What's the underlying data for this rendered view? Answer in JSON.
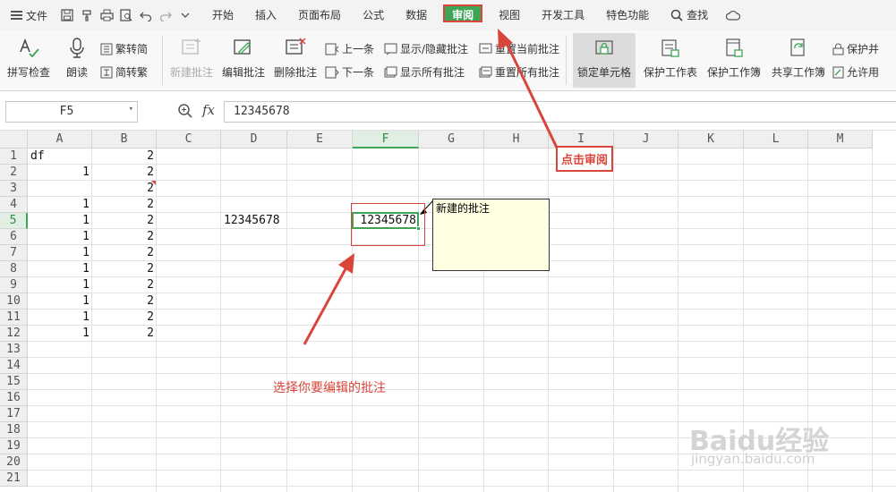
{
  "menubar": {
    "file_label": "文件",
    "tabs": [
      {
        "label": "开始"
      },
      {
        "label": "插入"
      },
      {
        "label": "页面布局"
      },
      {
        "label": "公式"
      },
      {
        "label": "数据"
      },
      {
        "label": "审阅",
        "active": true
      },
      {
        "label": "视图"
      },
      {
        "label": "开发工具"
      },
      {
        "label": "特色功能"
      }
    ],
    "search_label": "查找",
    "quick_icons": [
      "save-icon",
      "format-painter-icon",
      "print-icon",
      "print-preview-icon",
      "undo-icon",
      "redo-icon",
      "dropdown-icon"
    ]
  },
  "ribbon": {
    "spell_check": "拼写检查",
    "read_aloud": "朗读",
    "trad_to_simp": "繁转简",
    "simp_to_trad": "简转繁",
    "new_comment": "新建批注",
    "edit_comment": "编辑批注",
    "delete_comment": "删除批注",
    "prev": "上一条",
    "next": "下一条",
    "show_hide_comment": "显示/隐藏批注",
    "show_all_comments": "显示所有批注",
    "reset_current_comment": "重置当前批注",
    "reset_all_comments": "重置所有批注",
    "lock_cell": "锁定单元格",
    "protect_sheet": "保护工作表",
    "protect_workbook": "保护工作簿",
    "share_workbook": "共享工作簿",
    "protect_and": "保护并",
    "allow_edit": "允许用"
  },
  "formula_bar": {
    "name_box": "F5",
    "fx": "fx",
    "value": "12345678"
  },
  "sheet": {
    "columns": [
      "A",
      "B",
      "C",
      "D",
      "E",
      "F",
      "G",
      "H",
      "I",
      "J",
      "K",
      "L",
      "M"
    ],
    "selected_column": "F",
    "rows": [
      "1",
      "2",
      "3",
      "4",
      "5",
      "6",
      "7",
      "8",
      "9",
      "10",
      "11",
      "12",
      "13",
      "14",
      "15",
      "16",
      "17",
      "18",
      "19",
      "20",
      "21"
    ],
    "selected_row": "5",
    "cells": [
      {
        "ref": "A1",
        "value": "df",
        "align": "left"
      },
      {
        "ref": "B1",
        "value": "2",
        "align": "right"
      },
      {
        "ref": "A2",
        "value": "1",
        "align": "right"
      },
      {
        "ref": "B2",
        "value": "2",
        "align": "right"
      },
      {
        "ref": "B3",
        "value": "2",
        "align": "right"
      },
      {
        "ref": "A4",
        "value": "1",
        "align": "right"
      },
      {
        "ref": "B4",
        "value": "2",
        "align": "right"
      },
      {
        "ref": "A5",
        "value": "1",
        "align": "right"
      },
      {
        "ref": "B5",
        "value": "2",
        "align": "right"
      },
      {
        "ref": "D5",
        "value": "12345678",
        "align": "left"
      },
      {
        "ref": "F5",
        "value": "12345678",
        "align": "right"
      },
      {
        "ref": "A6",
        "value": "1",
        "align": "right"
      },
      {
        "ref": "B6",
        "value": "2",
        "align": "right"
      },
      {
        "ref": "A7",
        "value": "1",
        "align": "right"
      },
      {
        "ref": "B7",
        "value": "2",
        "align": "right"
      },
      {
        "ref": "A8",
        "value": "1",
        "align": "right"
      },
      {
        "ref": "B8",
        "value": "2",
        "align": "right"
      },
      {
        "ref": "A9",
        "value": "1",
        "align": "right"
      },
      {
        "ref": "B9",
        "value": "2",
        "align": "right"
      },
      {
        "ref": "A10",
        "value": "1",
        "align": "right"
      },
      {
        "ref": "B10",
        "value": "2",
        "align": "right"
      },
      {
        "ref": "A11",
        "value": "1",
        "align": "right"
      },
      {
        "ref": "B11",
        "value": "2",
        "align": "right"
      },
      {
        "ref": "A12",
        "value": "1",
        "align": "right"
      },
      {
        "ref": "B12",
        "value": "2",
        "align": "right"
      }
    ],
    "comment_text": "新建的批注"
  },
  "annotations": {
    "click_review": "点击审阅",
    "select_comment": "选择你要编辑的批注",
    "color": "#d9453b"
  },
  "watermark": {
    "brand": "Baidu经验",
    "url": "jingyan.baidu.com"
  },
  "colors": {
    "accent_green": "#3ea557",
    "annotation_red": "#d9453b",
    "comment_bg": "#ffffe1"
  }
}
